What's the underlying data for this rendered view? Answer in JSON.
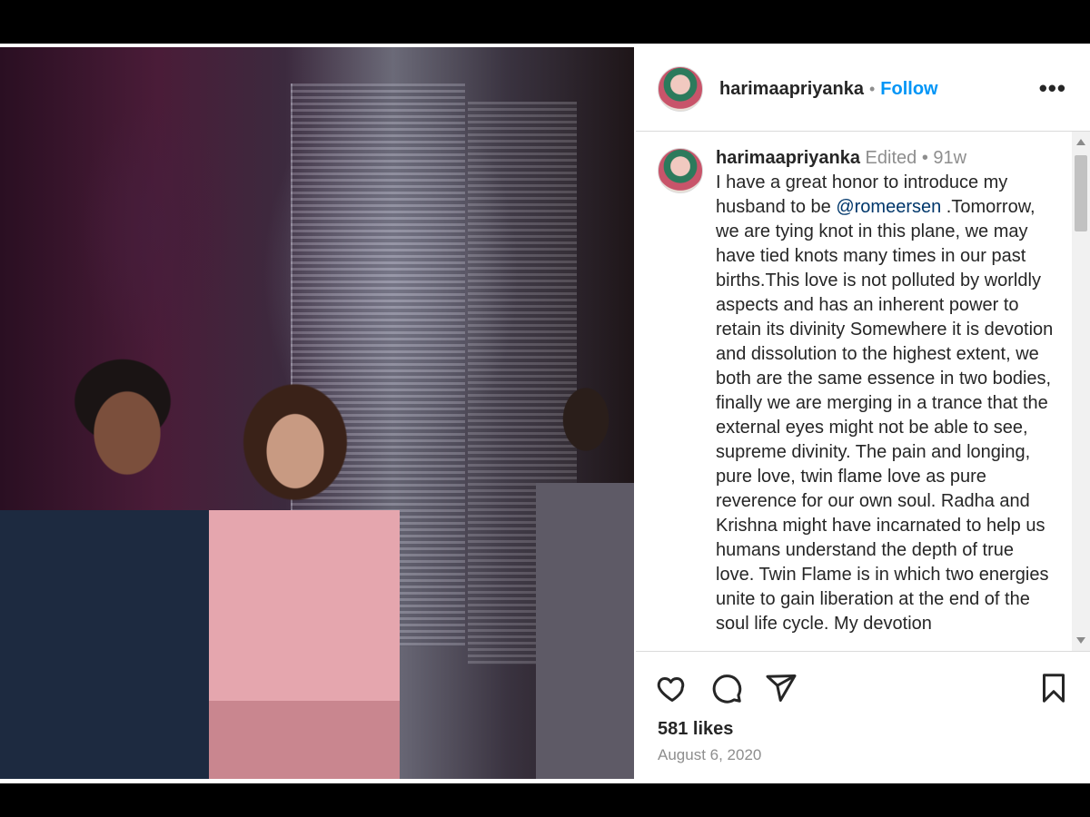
{
  "post": {
    "photo_alt": "",
    "header": {
      "username": "harimaapriyanka",
      "separator": "•",
      "follow_label": "Follow",
      "more_label": "•••"
    },
    "caption": {
      "username": "harimaapriyanka",
      "edited_label": "Edited",
      "separator": "•",
      "age": "91w",
      "text_before_mention": "I have a great honor to introduce my husband to be ",
      "mention": "@romeersen",
      "text_after_mention": " .Tomorrow, we are tying knot in this plane, we may have tied knots many times in our past births.This love is not polluted by worldly aspects and has an inherent power to retain its divinity Somewhere it is devotion and dissolution to the highest extent, we both are the same essence in two bodies, finally we are merging in a trance that the external eyes might not be able to see, supreme divinity. The pain and longing, pure love, twin flame love as pure reverence for our own soul. Radha and Krishna might have incarnated to help us humans understand the depth of true love.  Twin Flame is in which two energies unite to gain liberation at the end of the soul life cycle. My devotion"
    },
    "actions": {
      "like_icon": "heart-icon",
      "comment_icon": "comment-icon",
      "share_icon": "paper-plane-icon",
      "save_icon": "bookmark-icon"
    },
    "likes": "581 likes",
    "date": "August 6, 2020"
  },
  "colors": {
    "follow": "#0095f6",
    "mention": "#00376b",
    "text": "#262626",
    "muted": "#8e8e8e",
    "border": "#dbdbdb"
  }
}
